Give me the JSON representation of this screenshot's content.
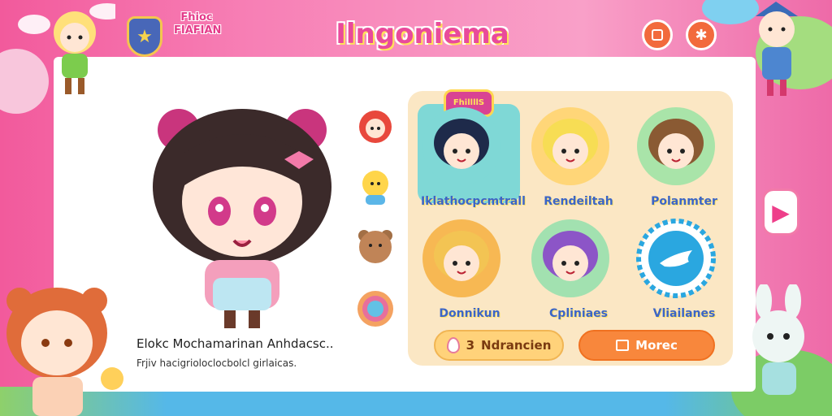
{
  "title": "Ilngoniema",
  "logo_text": "Fhioc FIAFIAN",
  "grid_banner": "FhillllS",
  "hero": {
    "name": "Elokc Mochamarinan Anhdacsc..",
    "description": "Frjiv hacigrioloclocbolcl girlaicas."
  },
  "characters": [
    {
      "label": "Iklathocpcmtrall",
      "color": "#7fd8d6",
      "hair": "#1e2a4a",
      "selected": true
    },
    {
      "label": "Rendeiltah",
      "color": "#ffd678",
      "hair": "#f7dd54",
      "selected": false
    },
    {
      "label": "Polanmter",
      "color": "#a9e4a9",
      "hair": "#8a5a33",
      "selected": false
    },
    {
      "label": "Donnikun",
      "color": "#f7b853",
      "hair": "#f3c453",
      "selected": false
    },
    {
      "label": "Cpliniaes",
      "color": "#a2e1b0",
      "hair": "#8c55c7",
      "selected": false
    },
    {
      "label": "Vliailanes",
      "color": "#2aa7e0",
      "hair": "#ffffff",
      "selected": false,
      "icon": "bird-icon"
    }
  ],
  "buttons": {
    "achievements": "Ndrancien",
    "achievements_count": "3",
    "more": "Morec"
  },
  "icons": {
    "badge": "star-shield-icon",
    "top_left_button": "square-icon",
    "top_right_button": "sparkle-icon",
    "nav_right": "play-icon"
  },
  "colors": {
    "accent_pink": "#e94a9b",
    "accent_orange": "#f8873c",
    "accent_blue": "#3b65c7"
  }
}
